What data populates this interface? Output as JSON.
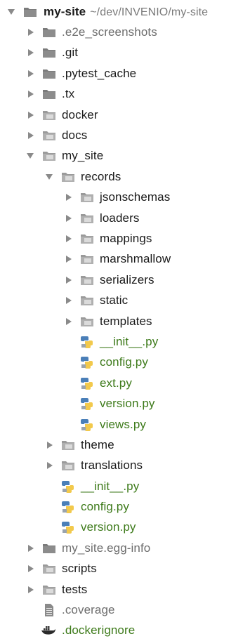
{
  "root": {
    "name": "my-site",
    "path": "~/dev/INVENIO/my-site"
  },
  "rows": [
    {
      "label": ".e2e_screenshots",
      "type": "folder",
      "state": "collapsed",
      "depth": 1,
      "color": "grey",
      "folder_style": "dark"
    },
    {
      "label": ".git",
      "type": "folder",
      "state": "collapsed",
      "depth": 1,
      "color": "dark",
      "folder_style": "dark"
    },
    {
      "label": ".pytest_cache",
      "type": "folder",
      "state": "collapsed",
      "depth": 1,
      "color": "dark",
      "folder_style": "dark"
    },
    {
      "label": ".tx",
      "type": "folder",
      "state": "collapsed",
      "depth": 1,
      "color": "dark",
      "folder_style": "dark"
    },
    {
      "label": "docker",
      "type": "folder",
      "state": "collapsed",
      "depth": 1,
      "color": "dark",
      "folder_style": "light"
    },
    {
      "label": "docs",
      "type": "folder",
      "state": "collapsed",
      "depth": 1,
      "color": "dark",
      "folder_style": "light"
    },
    {
      "label": "my_site",
      "type": "folder",
      "state": "expanded",
      "depth": 1,
      "color": "dark",
      "folder_style": "light"
    },
    {
      "label": "records",
      "type": "folder",
      "state": "expanded",
      "depth": 2,
      "color": "dark",
      "folder_style": "light"
    },
    {
      "label": "jsonschemas",
      "type": "folder",
      "state": "collapsed",
      "depth": 3,
      "color": "dark",
      "folder_style": "light"
    },
    {
      "label": "loaders",
      "type": "folder",
      "state": "collapsed",
      "depth": 3,
      "color": "dark",
      "folder_style": "light"
    },
    {
      "label": "mappings",
      "type": "folder",
      "state": "collapsed",
      "depth": 3,
      "color": "dark",
      "folder_style": "light"
    },
    {
      "label": "marshmallow",
      "type": "folder",
      "state": "collapsed",
      "depth": 3,
      "color": "dark",
      "folder_style": "light"
    },
    {
      "label": "serializers",
      "type": "folder",
      "state": "collapsed",
      "depth": 3,
      "color": "dark",
      "folder_style": "light"
    },
    {
      "label": "static",
      "type": "folder",
      "state": "collapsed",
      "depth": 3,
      "color": "dark",
      "folder_style": "light"
    },
    {
      "label": "templates",
      "type": "folder",
      "state": "collapsed",
      "depth": 3,
      "color": "dark",
      "folder_style": "light"
    },
    {
      "label": "__init__.py",
      "type": "python",
      "depth": 3,
      "color": "green"
    },
    {
      "label": "config.py",
      "type": "python",
      "depth": 3,
      "color": "green"
    },
    {
      "label": "ext.py",
      "type": "python",
      "depth": 3,
      "color": "green"
    },
    {
      "label": "version.py",
      "type": "python",
      "depth": 3,
      "color": "green"
    },
    {
      "label": "views.py",
      "type": "python",
      "depth": 3,
      "color": "green"
    },
    {
      "label": "theme",
      "type": "folder",
      "state": "collapsed",
      "depth": 2,
      "color": "dark",
      "folder_style": "light"
    },
    {
      "label": "translations",
      "type": "folder",
      "state": "collapsed",
      "depth": 2,
      "color": "dark",
      "folder_style": "light"
    },
    {
      "label": "__init__.py",
      "type": "python",
      "depth": 2,
      "color": "green"
    },
    {
      "label": "config.py",
      "type": "python",
      "depth": 2,
      "color": "green"
    },
    {
      "label": "version.py",
      "type": "python",
      "depth": 2,
      "color": "green"
    },
    {
      "label": "my_site.egg-info",
      "type": "folder",
      "state": "collapsed",
      "depth": 1,
      "color": "grey",
      "folder_style": "dark"
    },
    {
      "label": "scripts",
      "type": "folder",
      "state": "collapsed",
      "depth": 1,
      "color": "dark",
      "folder_style": "light"
    },
    {
      "label": "tests",
      "type": "folder",
      "state": "collapsed",
      "depth": 1,
      "color": "dark",
      "folder_style": "light"
    },
    {
      "label": ".coverage",
      "type": "file",
      "depth": 1,
      "color": "grey"
    },
    {
      "label": ".dockerignore",
      "type": "docker",
      "depth": 1,
      "color": "green"
    }
  ],
  "colors": {
    "dark_text": "#1a1a1a",
    "grey_text": "#6d6d6d",
    "green_text": "#3d7a1a",
    "arrow": "#8a8a8a",
    "folder_dark": "#7b7b7b",
    "folder_light": "#9a9a9a"
  }
}
